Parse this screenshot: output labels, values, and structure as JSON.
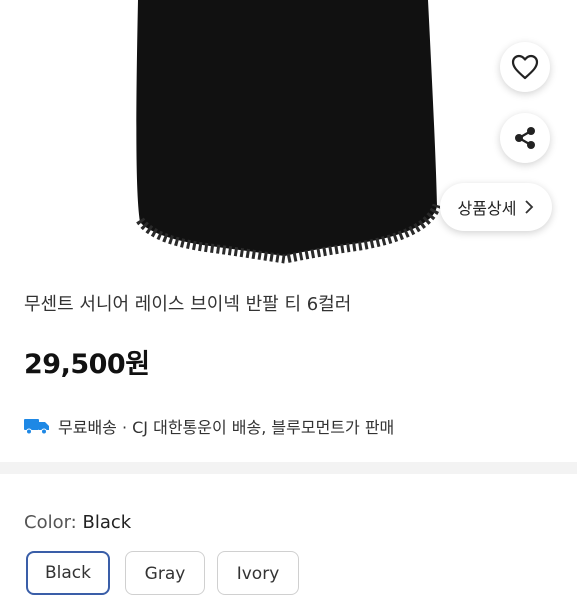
{
  "product": {
    "title": "무센트 서니어 레이스 브이넥 반팔 티 6컬러",
    "price": "29,500원"
  },
  "detail_button": {
    "label": "상품상세",
    "icon": "chevron-right-icon"
  },
  "actions": {
    "like_icon": "heart-icon",
    "share_icon": "share-icon"
  },
  "shipping": {
    "icon": "truck-icon",
    "text": "무료배송 · CJ 대한통운이 배송, 블루모먼트가 판매"
  },
  "options": {
    "color_prefix": "Color: ",
    "color_value": "Black",
    "chips": [
      "Black",
      "Gray",
      "Ivory"
    ]
  },
  "colors": {
    "accent": "#3a5ea8",
    "truck": "#1e88e5",
    "garment": "#111111"
  }
}
